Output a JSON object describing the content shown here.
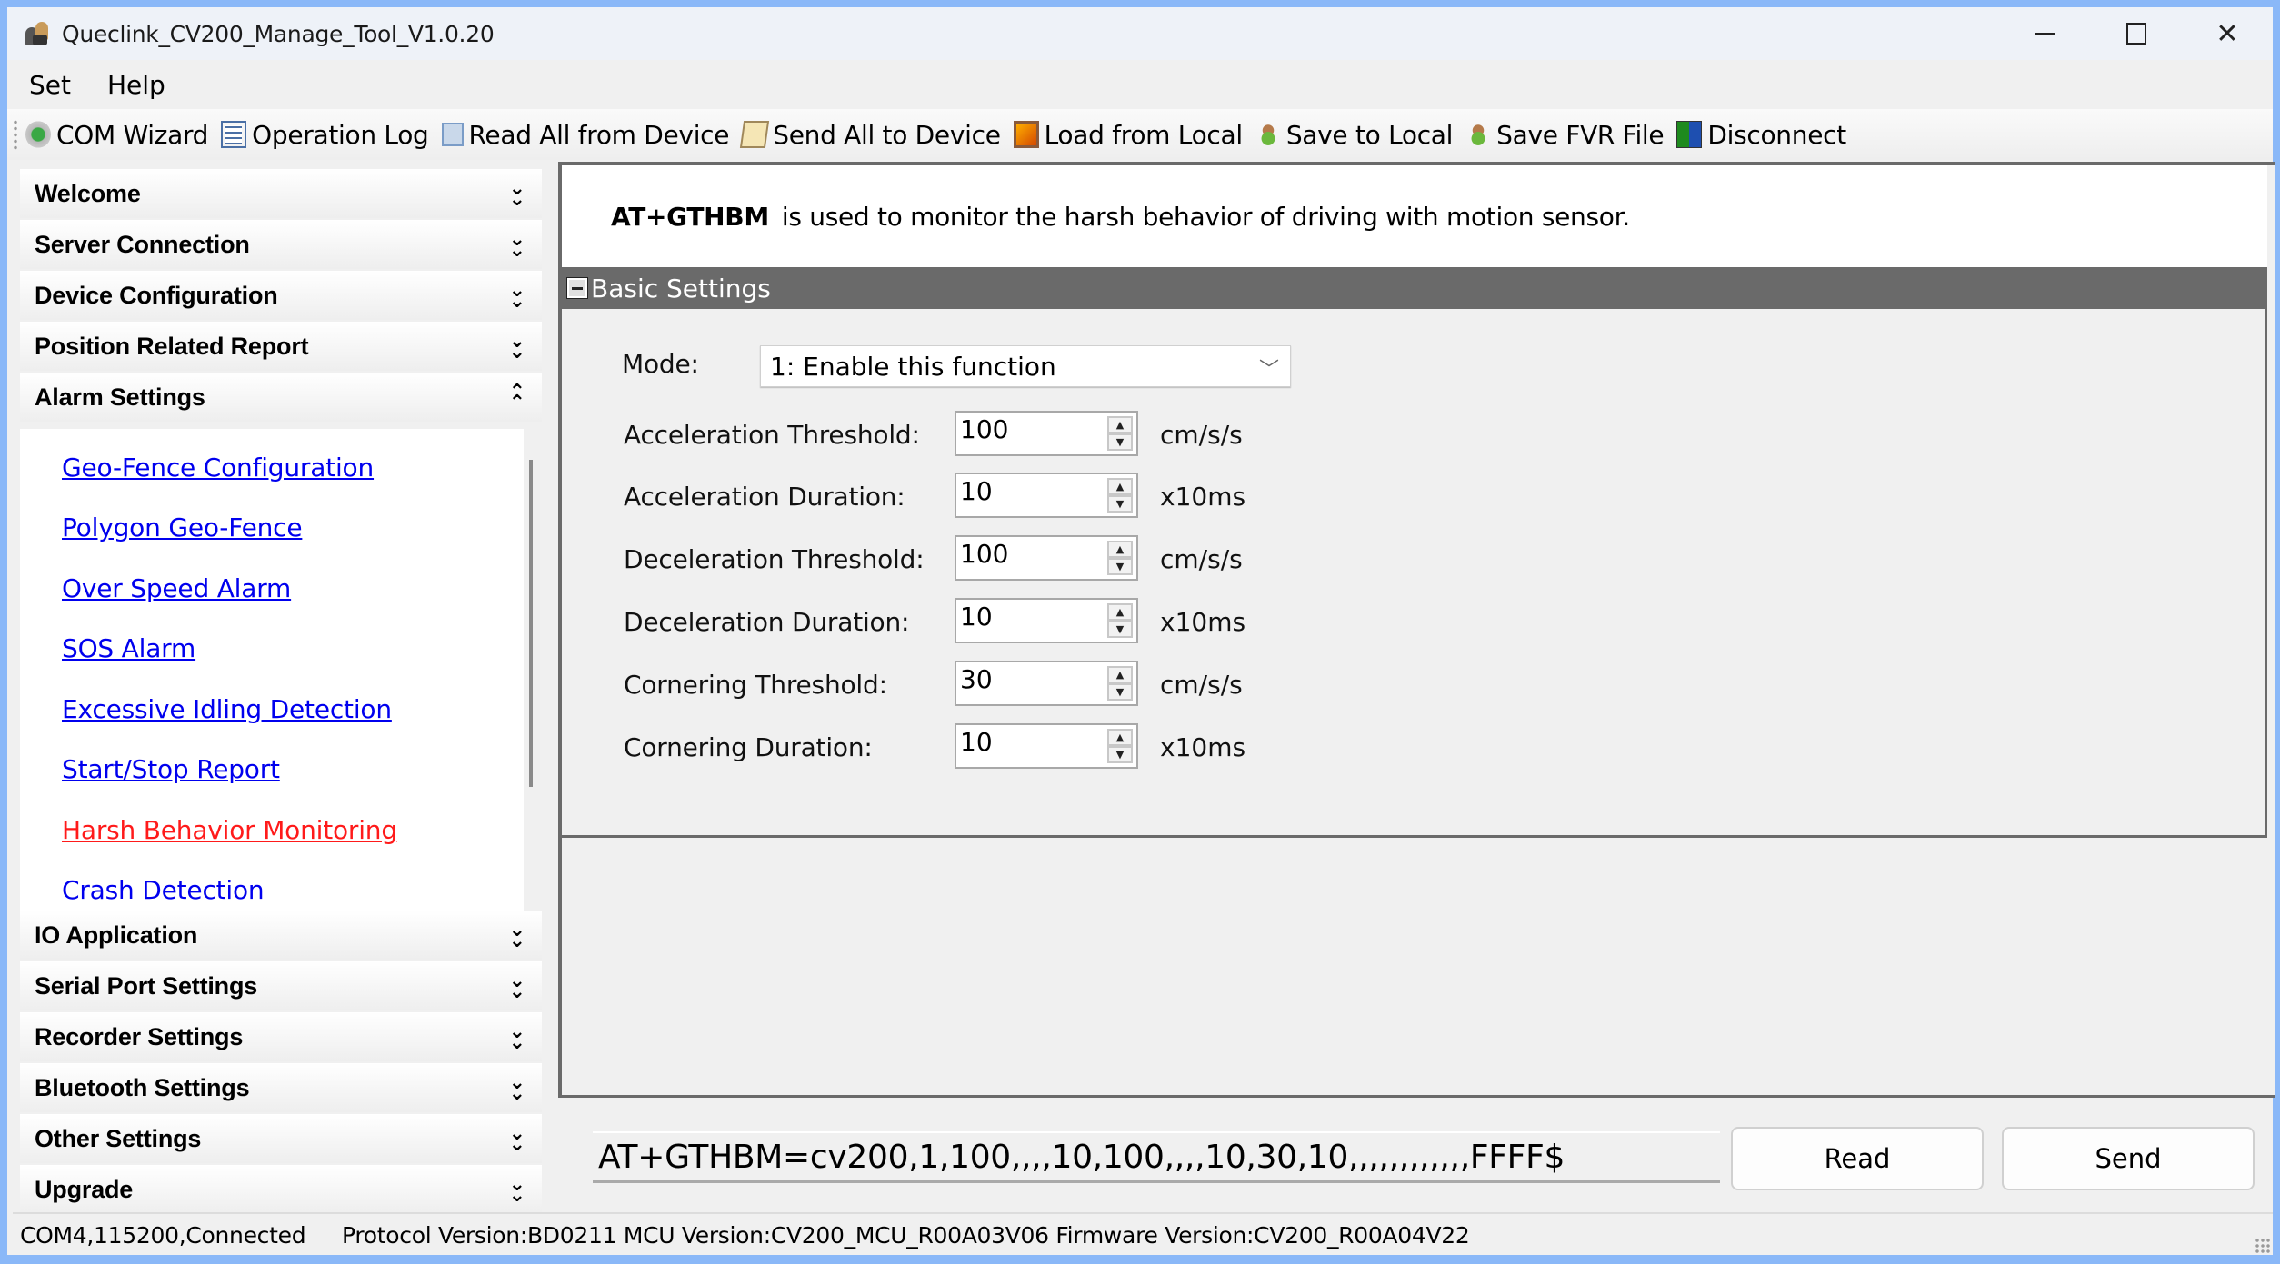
{
  "window": {
    "title": "Queclink_CV200_Manage_Tool_V1.0.20",
    "controls": {
      "minimize": "minimize",
      "maximize": "maximize",
      "close": "close"
    },
    "border_color": "#8ab8f8"
  },
  "menu": [
    "Set",
    "Help"
  ],
  "toolbar": [
    {
      "label": "COM Wizard",
      "icon": "gear-icon"
    },
    {
      "label": "Operation Log",
      "icon": "log-icon"
    },
    {
      "label": "Read All from Device",
      "icon": "read-device-icon"
    },
    {
      "label": "Send All to Device",
      "icon": "send-device-icon"
    },
    {
      "label": "Load from Local",
      "icon": "load-local-icon"
    },
    {
      "label": "Save to Local",
      "icon": "save-local-icon"
    },
    {
      "label": "Save FVR File",
      "icon": "save-fvr-icon"
    },
    {
      "label": "Disconnect",
      "icon": "disconnect-icon"
    }
  ],
  "sidebar": {
    "sections_top": [
      {
        "label": "Welcome",
        "expanded": false
      },
      {
        "label": "Server Connection",
        "expanded": false
      },
      {
        "label": "Device Configuration",
        "expanded": false
      },
      {
        "label": "Position Related Report",
        "expanded": false
      },
      {
        "label": "Alarm Settings",
        "expanded": true
      }
    ],
    "alarm_items": [
      {
        "label": "Geo-Fence Configuration",
        "active": false
      },
      {
        "label": "Polygon Geo-Fence",
        "active": false
      },
      {
        "label": "Over Speed Alarm",
        "active": false
      },
      {
        "label": "SOS Alarm",
        "active": false
      },
      {
        "label": "Excessive Idling Detection",
        "active": false
      },
      {
        "label": "Start/Stop Report",
        "active": false
      },
      {
        "label": "Harsh Behavior Monitoring",
        "active": true
      },
      {
        "label": "Crash Detection",
        "active": false
      }
    ],
    "sections_bottom": [
      {
        "label": "IO Application",
        "expanded": false
      },
      {
        "label": "Serial Port Settings",
        "expanded": false
      },
      {
        "label": "Recorder Settings",
        "expanded": false
      },
      {
        "label": "Bluetooth Settings",
        "expanded": false
      },
      {
        "label": "Other Settings",
        "expanded": false
      },
      {
        "label": "Upgrade",
        "expanded": false
      }
    ],
    "link_color": "#0000ee",
    "active_color": "#ff1a1a"
  },
  "main": {
    "command_name": "AT+GTHBM",
    "description": "is used to monitor the harsh behavior of driving with motion sensor.",
    "group_title": "Basic Settings",
    "mode_label": "Mode:",
    "mode_value": "1: Enable this function",
    "fields": [
      {
        "label": "Acceleration Threshold:",
        "value": "100",
        "unit": "cm/s/s"
      },
      {
        "label": "Acceleration Duration:",
        "value": "10",
        "unit": "x10ms"
      },
      {
        "label": "Deceleration  Threshold:",
        "value": "100",
        "unit": "cm/s/s"
      },
      {
        "label": "Deceleration Duration:",
        "value": "10",
        "unit": "x10ms"
      },
      {
        "label": "Cornering Threshold:",
        "value": "30",
        "unit": "cm/s/s"
      },
      {
        "label": "Cornering Duration:",
        "value": "10",
        "unit": "x10ms"
      }
    ]
  },
  "command": {
    "value": "AT+GTHBM=cv200,1,100,,,,10,100,,,,10,30,10,,,,,,,,,,,,FFFF$",
    "read_label": "Read",
    "send_label": "Send"
  },
  "status": {
    "connection": "COM4,115200,Connected",
    "versions": "Protocol Version:BD0211  MCU Version:CV200_MCU_R00A03V06  Firmware Version:CV200_R00A04V22"
  }
}
